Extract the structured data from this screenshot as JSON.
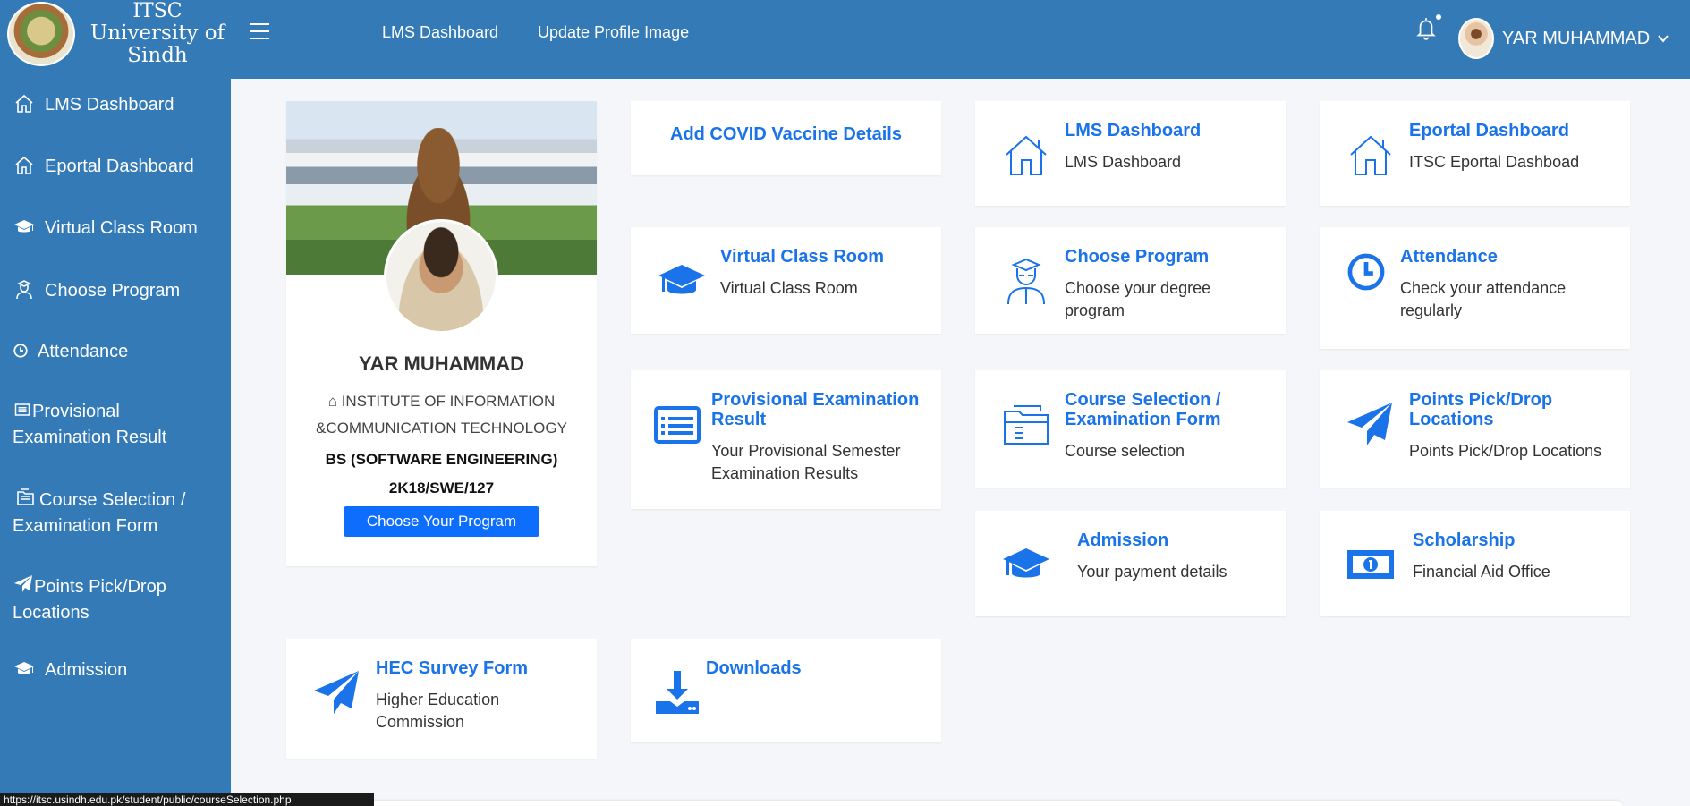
{
  "brand": {
    "line1": "ITSC",
    "line2": "University of Sindh"
  },
  "sidebar": {
    "items": [
      {
        "label": "LMS Dashboard",
        "icon": "home-icon"
      },
      {
        "label": "Eportal Dashboard",
        "icon": "home-icon"
      },
      {
        "label": "Virtual Class Room",
        "icon": "graduation-cap-icon"
      },
      {
        "label": "Choose Program",
        "icon": "user-graduate-icon"
      },
      {
        "label": "Attendance",
        "icon": "clock-icon"
      },
      {
        "label": "Provisional Examination Result",
        "icon": "list-alt-icon"
      },
      {
        "label": "Course Selection / Examination Form",
        "icon": "folder-open-icon"
      },
      {
        "label": "Points Pick/Drop Locations",
        "icon": "paper-plane-icon"
      },
      {
        "label": "Admission",
        "icon": "graduation-cap-icon"
      }
    ]
  },
  "topbar": {
    "links": [
      "LMS Dashboard",
      "Update Profile Image"
    ],
    "user_name": "YAR MUHAMMAD"
  },
  "profile": {
    "name": "YAR MUHAMMAD",
    "institute": "INSTITUTE OF INFORMATION &COMMUNICATION TECHNOLOGY",
    "program": "BS (SOFTWARE ENGINEERING)",
    "roll_no": "2K18/SWE/127",
    "button": "Choose Your Program"
  },
  "tiles": {
    "covid": {
      "title": "Add COVID Vaccine Details"
    },
    "lms": {
      "title": "LMS Dashboard",
      "desc": "LMS Dashboard",
      "icon": "home-icon"
    },
    "eportal": {
      "title": "Eportal Dashboard",
      "desc": "ITSC Eportal Dashboad",
      "icon": "home-icon"
    },
    "vcr": {
      "title": "Virtual Class Room",
      "desc": "Virtual Class Room",
      "icon": "graduation-cap-icon"
    },
    "choose": {
      "title": "Choose Program",
      "desc": "Choose your degree program",
      "icon": "user-graduate-icon"
    },
    "attendance": {
      "title": "Attendance",
      "desc": "Check your attendance regularly",
      "icon": "clock-icon"
    },
    "result": {
      "title": "Provisional Examination Result",
      "desc": "Your Provisional Semester Examination Results",
      "icon": "list-alt-icon"
    },
    "course": {
      "title": "Course Selection / Examination Form",
      "desc": "Course selection",
      "icon": "folder-open-icon"
    },
    "points": {
      "title": "Points Pick/Drop Locations",
      "desc": "Points Pick/Drop Locations",
      "icon": "paper-plane-icon"
    },
    "admission": {
      "title": "Admission",
      "desc": "Your payment details",
      "icon": "graduation-cap-icon"
    },
    "scholarship": {
      "title": "Scholarship",
      "desc": "Financial Aid Office",
      "icon": "money-bill-icon"
    },
    "hec": {
      "title": "HEC Survey Form",
      "desc": "Higher Education Commission",
      "icon": "paper-plane-icon"
    },
    "downloads": {
      "title": "Downloads",
      "icon": "download-icon"
    }
  },
  "status_url": "https://itsc.usindh.edu.pk/student/public/courseSelection.php",
  "colors": {
    "primary": "#337ab7",
    "accent": "#1a73e8",
    "button": "#0d6efd",
    "background": "#f4f6f9"
  }
}
